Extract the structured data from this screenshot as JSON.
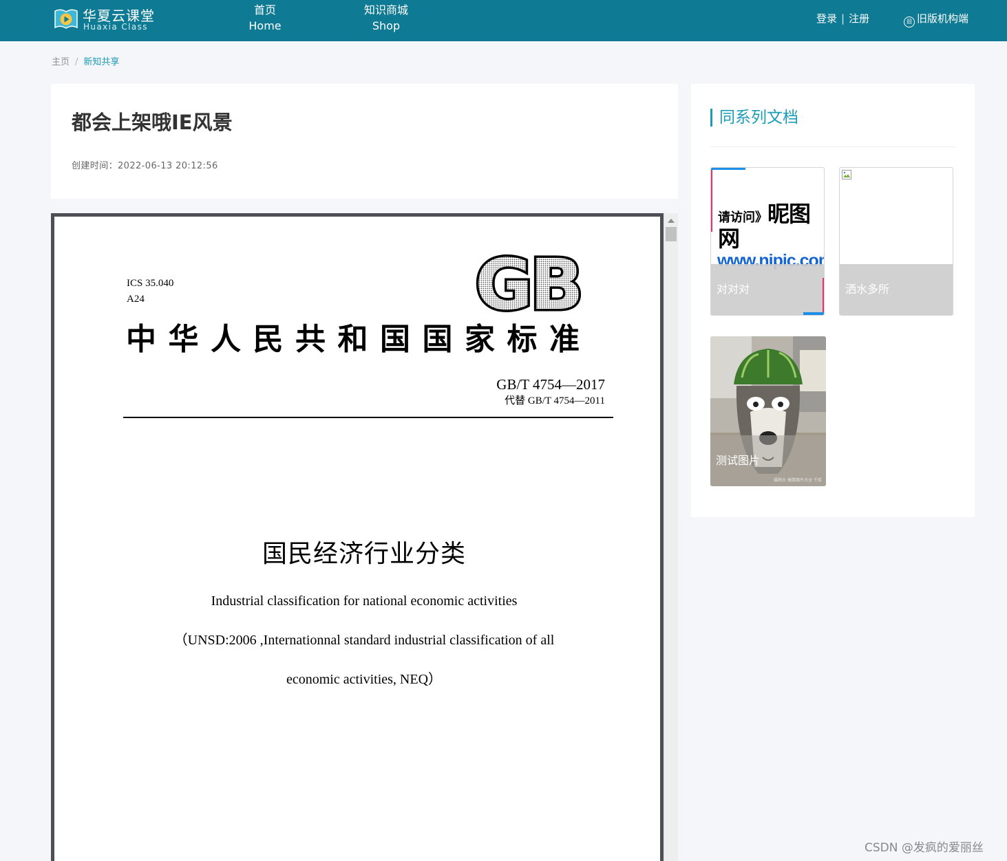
{
  "header": {
    "logo_cn": "华夏云课堂",
    "logo_en": "Huaxia Class",
    "nav": [
      {
        "cn": "首页",
        "en": "Home"
      },
      {
        "cn": "知识商城",
        "en": "Shop"
      }
    ],
    "login": "登录",
    "separator": "|",
    "register": "注册",
    "old_site_icon": "旧",
    "old_site": "旧版机构端"
  },
  "breadcrumb": {
    "home": "主页",
    "separator": "/",
    "current": "新知共享"
  },
  "document": {
    "title": "都会上架哦IE风景",
    "meta": "创建时间：2022-06-13 20:12:56"
  },
  "viewer": {
    "ics": "ICS 35.040",
    "class_code": "A24",
    "logo_text": "GB",
    "standard_name": "中华人民共和国国家标准",
    "standard_code": "GB/T 4754—2017",
    "replaces": "代替 GB/T 4754—2011",
    "title_cn": "国民经济行业分类",
    "title_en_1": "Industrial classification for national economic activities",
    "title_en_2": "（UNSD:2006 ,Internationnal standard industrial classification of all",
    "title_en_3": "economic activities, NEQ）"
  },
  "sidebar": {
    "title": "同系列文档",
    "items": [
      {
        "label": "对对对",
        "image_text_1": "请访问》",
        "image_text_2": "昵图网",
        "image_text_3": "www.nipic.com"
      },
      {
        "label": "洒水多所"
      },
      {
        "label": "测试图片",
        "image_caption": "猫狗头 搞笑图片大全 千库"
      }
    ]
  },
  "watermark": "CSDN @发疯的爱丽丝",
  "colors": {
    "header_bg": "#0f7a93",
    "accent": "#1a9bb8",
    "page_bg": "#f5f6fa"
  }
}
